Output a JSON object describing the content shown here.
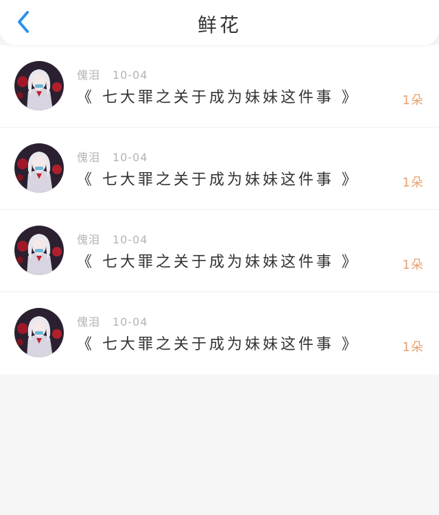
{
  "header": {
    "title": "鲜花",
    "back_icon": "chevron-left-icon",
    "accent_color": "#2a8ff0"
  },
  "records": [
    {
      "user": "傀泪",
      "date": "10-04",
      "book": "《 七大罪之关于成为妹妹这件事 》",
      "amount": "1朵"
    },
    {
      "user": "傀泪",
      "date": "10-04",
      "book": "《 七大罪之关于成为妹妹这件事 》",
      "amount": "1朵"
    },
    {
      "user": "傀泪",
      "date": "10-04",
      "book": "《 七大罪之关于成为妹妹这件事 》",
      "amount": "1朵"
    },
    {
      "user": "傀泪",
      "date": "10-04",
      "book": "《 七大罪之关于成为妹妹这件事 》",
      "amount": "1朵"
    }
  ],
  "colors": {
    "amount": "#e6a070",
    "meta": "#b3b3b3",
    "background": "#f7f6f7"
  }
}
